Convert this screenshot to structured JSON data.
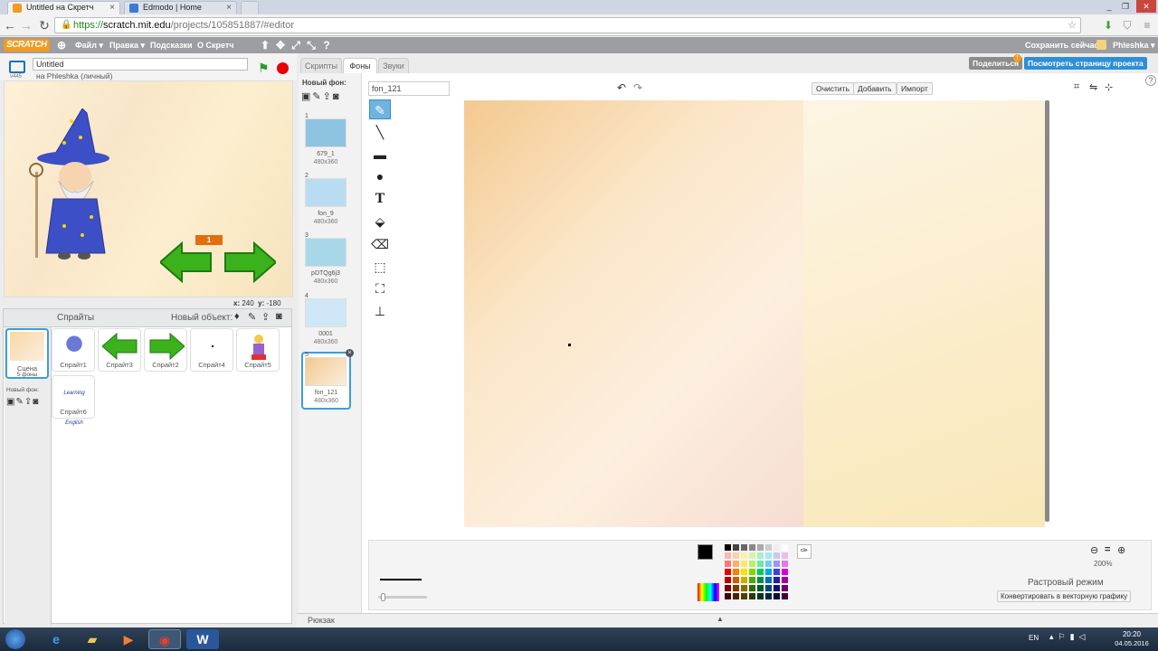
{
  "browser": {
    "tabs": [
      {
        "title": "Untitled на Скретч"
      },
      {
        "title": "Edmodo | Home"
      }
    ],
    "url_scheme": "https://",
    "url_host": "scratch.mit.edu",
    "url_path": "/projects/105851887/#editor",
    "window_controls": [
      "_",
      "❐",
      "✕"
    ]
  },
  "menubar": {
    "logo": "SCRATCH",
    "items": [
      "Файл ▾",
      "Правка ▾",
      "Подсказки",
      "О Скретч"
    ],
    "save_now": "Сохранить сейчас",
    "user": "Phleshka ▾"
  },
  "project": {
    "title": "Untitled",
    "owner": "на Phleshka (личный)",
    "version": "v445"
  },
  "stage": {
    "coords_x_label": "x:",
    "coords_x": "240",
    "coords_y_label": "y:",
    "coords_y": "-180",
    "counter": "1"
  },
  "sprites_pane": {
    "title": "Спрайты",
    "new_object": "Новый объект:",
    "stage_label": "Сцена",
    "stage_backdrops": "5 фоны",
    "new_backdrop": "Новый фон:",
    "sprites": [
      {
        "name": "Спрайт1"
      },
      {
        "name": "Спрайт3"
      },
      {
        "name": "Спрайт2"
      },
      {
        "name": "Спрайт4"
      },
      {
        "name": "Спрайт5"
      },
      {
        "name": "Спрайт6",
        "text": "Learning English"
      }
    ]
  },
  "editor_tabs": [
    {
      "label": "Скрипты",
      "active": false
    },
    {
      "label": "Фоны",
      "active": true
    },
    {
      "label": "Звуки",
      "active": false
    }
  ],
  "share": {
    "share_label": "Поделиться",
    "see_page_label": "Посмотреть страницу проекта"
  },
  "backdrops_panel": {
    "new_backdrop": "Новый фон:",
    "items": [
      {
        "num": "1",
        "name": "679_1",
        "size": "480x360",
        "color": "#8fc3e2"
      },
      {
        "num": "2",
        "name": "fon_9",
        "size": "480x360",
        "color": "#b9dcf2"
      },
      {
        "num": "3",
        "name": "pDTQg6j3",
        "size": "480x360",
        "color": "#a8d8e8"
      },
      {
        "num": "4",
        "name": "0001",
        "size": "480x360",
        "color": "#cfe7f6"
      },
      {
        "num": "5",
        "name": "fon_121",
        "size": "480x360",
        "color": "#f6ddb8"
      }
    ]
  },
  "paint_editor": {
    "costume_name": "fon_121",
    "clear": "Очистить",
    "add": "Добавить",
    "import": "Импорт",
    "zoom": "200%",
    "zoom_reset": "=",
    "mode": "Растровый режим",
    "convert": "Конвертировать в векторную графику"
  },
  "palette": {
    "rows": [
      [
        "#000000",
        "#444444",
        "#666666",
        "#888888",
        "#aaaaaa",
        "#cccccc",
        "#eeeeee",
        "#ffffff"
      ],
      [
        "#f9b8b0",
        "#fbd3a8",
        "#fdf0a8",
        "#d7f5a8",
        "#a8f0c8",
        "#a8e8f5",
        "#c8c8f8",
        "#f0b8f0"
      ],
      [
        "#f87878",
        "#f8b070",
        "#f8e870",
        "#b8f070",
        "#70e8a8",
        "#70d0f0",
        "#9898f0",
        "#e878e8"
      ],
      [
        "#e80000",
        "#f88000",
        "#f8e000",
        "#80d800",
        "#00c860",
        "#00a8e8",
        "#4040e0",
        "#d800d8"
      ],
      [
        "#b80000",
        "#c86000",
        "#c8b000",
        "#50a800",
        "#009040",
        "#0070b8",
        "#2020a8",
        "#a000a0"
      ],
      [
        "#780000",
        "#803800",
        "#807000",
        "#306800",
        "#005828",
        "#004878",
        "#101070",
        "#680068"
      ],
      [
        "#480000",
        "#502000",
        "#504000",
        "#204000",
        "#003818",
        "#002848",
        "#080840",
        "#400040"
      ]
    ]
  },
  "backpack": {
    "label": "Рюкзак"
  },
  "taskbar": {
    "lang": "EN",
    "time": "20:20",
    "date": "04.05.2016"
  }
}
